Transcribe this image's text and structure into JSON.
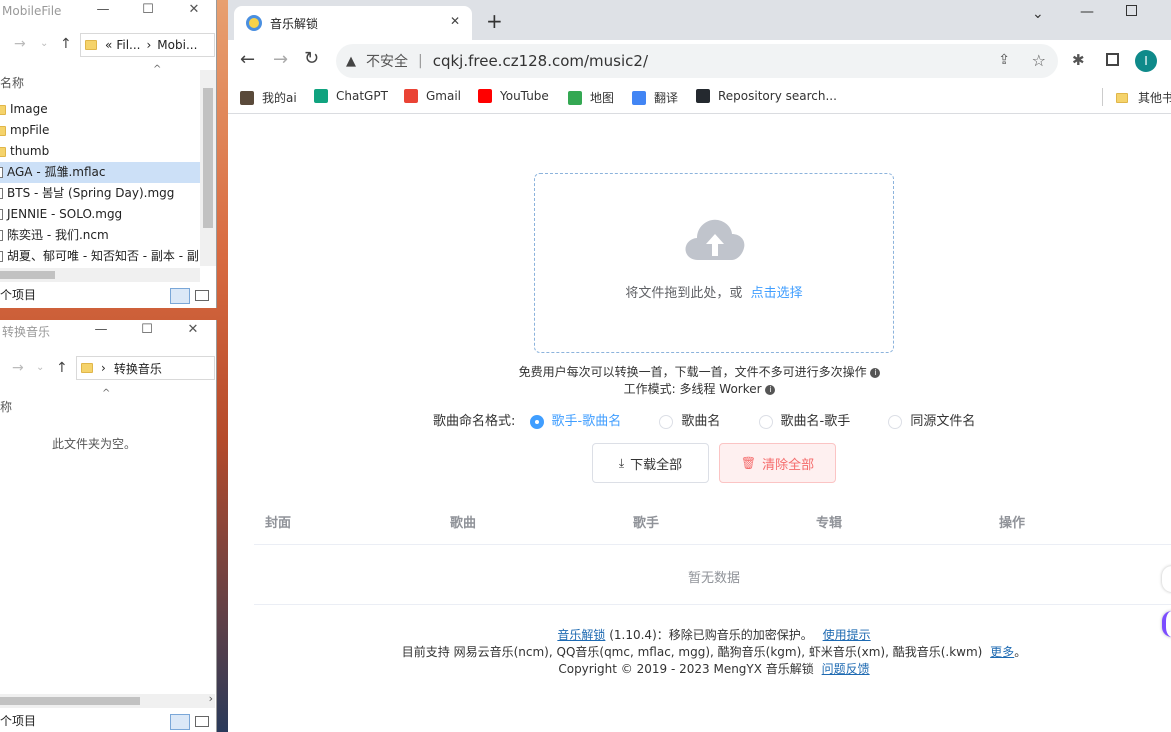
{
  "explorer1": {
    "title": "MobileFile",
    "breadcrumb": [
      "«",
      "Fil...",
      "›",
      "Mobi..."
    ],
    "column_header": "名称",
    "items": [
      {
        "name": "Image",
        "type": "folder"
      },
      {
        "name": "mpFile",
        "type": "folder"
      },
      {
        "name": "thumb",
        "type": "folder"
      },
      {
        "name": "AGA - 孤雏.mflac",
        "type": "file",
        "selected": true
      },
      {
        "name": "BTS - 봄날 (Spring Day).mgg",
        "type": "file"
      },
      {
        "name": "JENNIE - SOLO.mgg",
        "type": "file"
      },
      {
        "name": "陈奕迅 - 我们.ncm",
        "type": "file"
      },
      {
        "name": "胡夏、郁可唯 - 知否知否 - 副本 - 副",
        "type": "file"
      }
    ],
    "status": "个项目"
  },
  "explorer2": {
    "title": "转换音乐",
    "breadcrumb": [
      "›",
      "转换音乐"
    ],
    "column_header": "称",
    "empty_text": "此文件夹为空。",
    "status": "个项目"
  },
  "browser": {
    "tab_title": "音乐解锁",
    "security_label": "不安全",
    "url": "cqkj.free.cz128.com/music2/",
    "profile_initial": "I",
    "bookmarks": [
      {
        "label": "我的ai",
        "icon": "ai-icon",
        "color": "#5a4a3a"
      },
      {
        "label": "ChatGPT",
        "icon": "chatgpt-icon",
        "color": "#10a37f"
      },
      {
        "label": "Gmail",
        "icon": "gmail-icon",
        "color": "#ea4335"
      },
      {
        "label": "YouTube",
        "icon": "youtube-icon",
        "color": "#ff0000"
      },
      {
        "label": "地图",
        "icon": "maps-icon",
        "color": "#34a853"
      },
      {
        "label": "翻译",
        "icon": "translate-icon",
        "color": "#4285f4"
      },
      {
        "label": "Repository search...",
        "icon": "github-icon",
        "color": "#24292f"
      }
    ],
    "other_bookmarks": "其他书"
  },
  "page": {
    "upload_text": "将文件拖到此处，或",
    "upload_link": "点击选择",
    "note1": "免费用户每次可以转换一首，下载一首，文件不多可进行多次操作",
    "note2": "工作模式: 多线程 Worker",
    "format_label": "歌曲命名格式:",
    "format_options": [
      "歌手-歌曲名",
      "歌曲名",
      "歌曲名-歌手",
      "同源文件名"
    ],
    "selected_format": 0,
    "download_all": "下载全部",
    "clear_all": "清除全部",
    "table_headers": [
      "封面",
      "歌曲",
      "歌手",
      "专辑",
      "操作"
    ],
    "empty_data": "暂无数据",
    "footer": {
      "app_link": "音乐解锁",
      "version": "(1.10.4)：移除已购音乐的加密保护。",
      "tips_link": "使用提示",
      "support": "目前支持 网易云音乐(ncm), QQ音乐(qmc, mflac, mgg), 酷狗音乐(kgm), 虾米音乐(xm), 酷我音乐(.kwm)",
      "more_link": "更多",
      "period": "。",
      "copyright": "Copyright © 2019 - 2023 MengYX 音乐解锁",
      "feedback_link": "问题反馈"
    }
  },
  "colors": {
    "accent": "#409eff",
    "danger": "#f56c6c",
    "link": "#1e6ab2"
  }
}
